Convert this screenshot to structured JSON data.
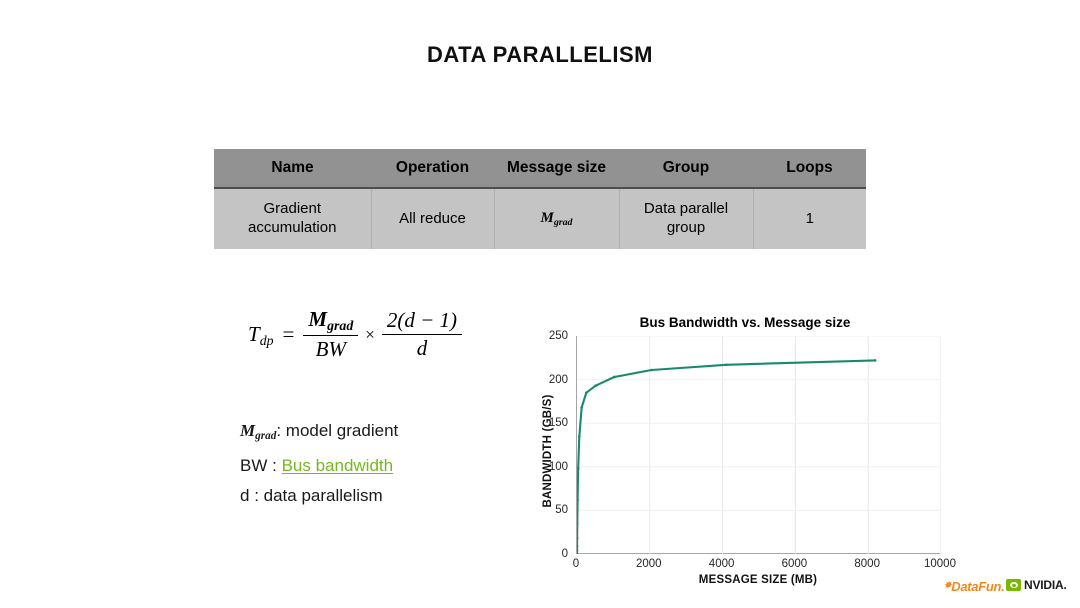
{
  "slide": {
    "title": "DATA PARALLELISM"
  },
  "table": {
    "headers": [
      "Name",
      "Operation",
      "Message size",
      "Group",
      "Loops"
    ],
    "rows": [
      {
        "name": "Gradient accumulation",
        "operation": "All reduce",
        "message_size_base": "M",
        "message_size_sub": "grad",
        "group": "Data parallel group",
        "loops": "1"
      }
    ]
  },
  "formula": {
    "lhs_base": "T",
    "lhs_sub": "dp",
    "equals": "=",
    "frac1_num_base": "M",
    "frac1_num_sub": "grad",
    "frac1_den": "BW",
    "times": "×",
    "frac2_num": "2(d − 1)",
    "frac2_den": "d"
  },
  "definitions": [
    {
      "term_base": "M",
      "term_sub": "grad",
      "separator": ": ",
      "desc": "model gradient",
      "is_link": false
    },
    {
      "term_base": "BW",
      "term_sub": "",
      "separator": " : ",
      "desc": "Bus bandwidth",
      "is_link": true
    },
    {
      "term_base": "d",
      "term_sub": "",
      "separator": " : ",
      "desc": "data parallelism",
      "is_link": false
    }
  ],
  "chart_data": {
    "type": "line",
    "title": "Bus Bandwidth vs. Message size",
    "xlabel": "MESSAGE SIZE (MB)",
    "ylabel": "BANDWIDTH (GB/S)",
    "xlim": [
      0,
      10000
    ],
    "ylim": [
      0,
      250
    ],
    "xticks": [
      0,
      2000,
      4000,
      6000,
      8000,
      10000
    ],
    "yticks": [
      0,
      50,
      100,
      150,
      200,
      250
    ],
    "grid": true,
    "legend": "none",
    "line_color": "#1a8a6e",
    "series": [
      {
        "name": "Bus bandwidth",
        "x": [
          0,
          1,
          2,
          4,
          8,
          16,
          32,
          64,
          128,
          256,
          512,
          1024,
          2048,
          4096,
          8192
        ],
        "y": [
          0,
          4,
          9,
          18,
          35,
          62,
          98,
          135,
          168,
          185,
          193,
          203,
          211,
          217,
          222
        ]
      }
    ]
  },
  "footer": {
    "datafun_label": "DataFun.",
    "nvidia_label": "NVIDIA."
  },
  "colors": {
    "accent_green": "#76b900",
    "link_green": "#76b820",
    "chart_line": "#1a8a6e",
    "table_header_bg": "#929292",
    "table_body_bg": "#c4c4c4",
    "datafun_orange": "#f08a1e"
  }
}
